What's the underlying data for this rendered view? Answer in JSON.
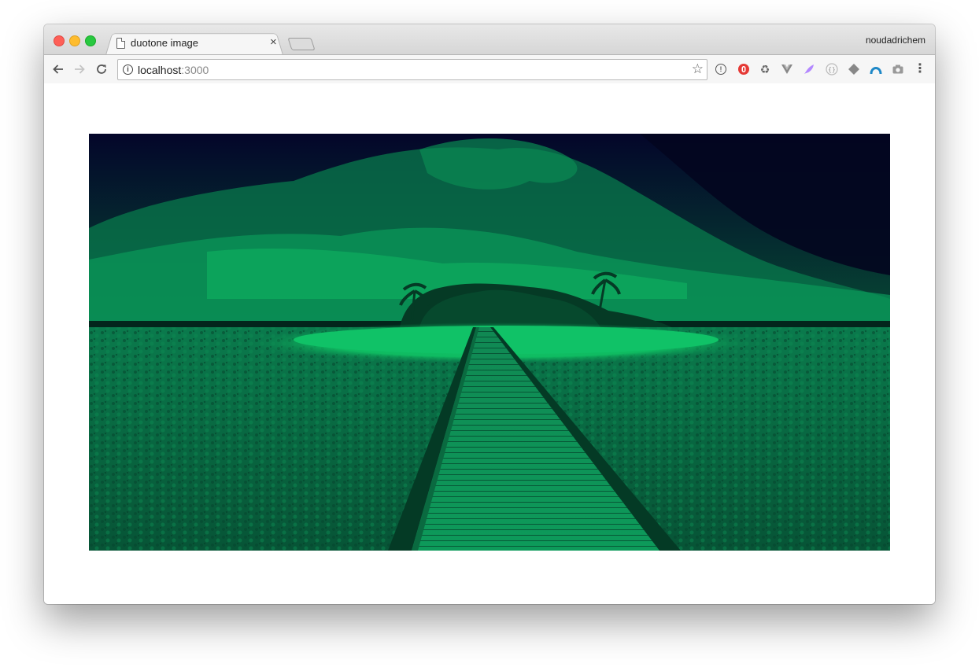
{
  "browser": {
    "tab": {
      "title": "duotone image",
      "icon": "document-icon",
      "close_glyph": "×"
    },
    "profile_name": "noudadrichem",
    "address_bar": {
      "host": "localhost",
      "port": ":3000"
    },
    "extensions": [
      "password-manager-icon",
      "ublock-icon",
      "recycle-icon",
      "vue-devtools-icon",
      "feather-icon",
      "braces-icon",
      "layers-icon",
      "arc-icon",
      "camera-icon"
    ]
  },
  "page": {
    "image": {
      "description_name": "duotone-island-boardwalk-image",
      "colors": {
        "dark": "#04062a",
        "light": "#0fc164"
      }
    }
  }
}
